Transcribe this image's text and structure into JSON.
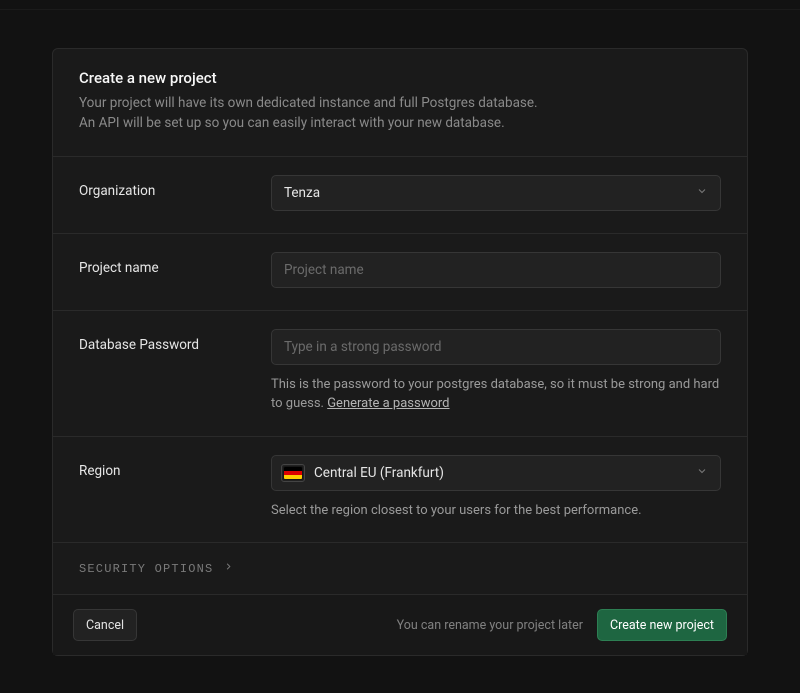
{
  "header": {
    "title": "Create a new project",
    "desc_line1": "Your project will have its own dedicated instance and full Postgres database.",
    "desc_line2": "An API will be set up so you can easily interact with your new database."
  },
  "fields": {
    "organization": {
      "label": "Organization",
      "value": "Tenza"
    },
    "project_name": {
      "label": "Project name",
      "placeholder": "Project name",
      "value": ""
    },
    "db_password": {
      "label": "Database Password",
      "placeholder": "Type in a strong password",
      "value": "",
      "helper_prefix": "This is the password to your postgres database, so it must be strong and hard to guess. ",
      "helper_link": "Generate a password"
    },
    "region": {
      "label": "Region",
      "value": "Central EU (Frankfurt)",
      "helper": "Select the region closest to your users for the best performance."
    }
  },
  "security_options": {
    "label": "SECURITY OPTIONS"
  },
  "footer": {
    "cancel": "Cancel",
    "note": "You can rename your project later",
    "submit": "Create new project"
  }
}
